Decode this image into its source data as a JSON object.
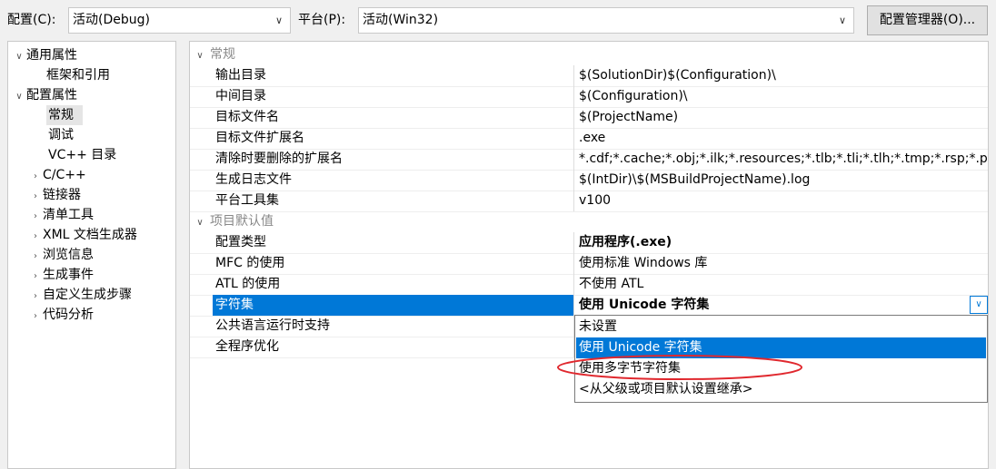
{
  "toolbar": {
    "config_label": "配置(C):",
    "config_value": "活动(Debug)",
    "platform_label": "平台(P):",
    "platform_value": "活动(Win32)",
    "config_manager_button": "配置管理器(O)..."
  },
  "tree": {
    "items": [
      {
        "label": "通用属性",
        "expander": "v"
      },
      {
        "label": "框架和引用"
      },
      {
        "label": "配置属性",
        "expander": "v"
      },
      {
        "label": "常规",
        "selected": true
      },
      {
        "label": "调试"
      },
      {
        "label": "VC++ 目录"
      },
      {
        "label": "C/C++",
        "expander": ">"
      },
      {
        "label": "链接器",
        "expander": ">"
      },
      {
        "label": "清单工具",
        "expander": ">"
      },
      {
        "label": "XML 文档生成器",
        "expander": ">"
      },
      {
        "label": "浏览信息",
        "expander": ">"
      },
      {
        "label": "生成事件",
        "expander": ">"
      },
      {
        "label": "自定义生成步骤",
        "expander": ">"
      },
      {
        "label": "代码分析",
        "expander": ">"
      }
    ]
  },
  "grid": {
    "cat_general": "常规",
    "cat_defaults": "项目默认值",
    "general_rows": [
      {
        "name": "输出目录",
        "value": "$(SolutionDir)$(Configuration)\\"
      },
      {
        "name": "中间目录",
        "value": "$(Configuration)\\"
      },
      {
        "name": "目标文件名",
        "value": "$(ProjectName)"
      },
      {
        "name": "目标文件扩展名",
        "value": ".exe"
      },
      {
        "name": "清除时要删除的扩展名",
        "value": "*.cdf;*.cache;*.obj;*.ilk;*.resources;*.tlb;*.tli;*.tlh;*.tmp;*.rsp;*.p"
      },
      {
        "name": "生成日志文件",
        "value": "$(IntDir)\\$(MSBuildProjectName).log"
      },
      {
        "name": "平台工具集",
        "value": "v100"
      }
    ],
    "default_rows": [
      {
        "name": "配置类型",
        "value": "应用程序(.exe)"
      },
      {
        "name": "MFC 的使用",
        "value": "使用标准 Windows 库"
      },
      {
        "name": "ATL 的使用",
        "value": "不使用 ATL"
      },
      {
        "name": "字符集",
        "value": "使用 Unicode 字符集"
      },
      {
        "name": "公共语言运行时支持",
        "value": ""
      },
      {
        "name": "全程序优化",
        "value": ""
      }
    ]
  },
  "dropdown": {
    "options": [
      "未设置",
      "使用 Unicode 字符集",
      "使用多字节字符集",
      "<从父级或项目默认设置继承>"
    ]
  },
  "colors": {
    "selection": "#0078d7",
    "annotation": "#e0282e"
  }
}
